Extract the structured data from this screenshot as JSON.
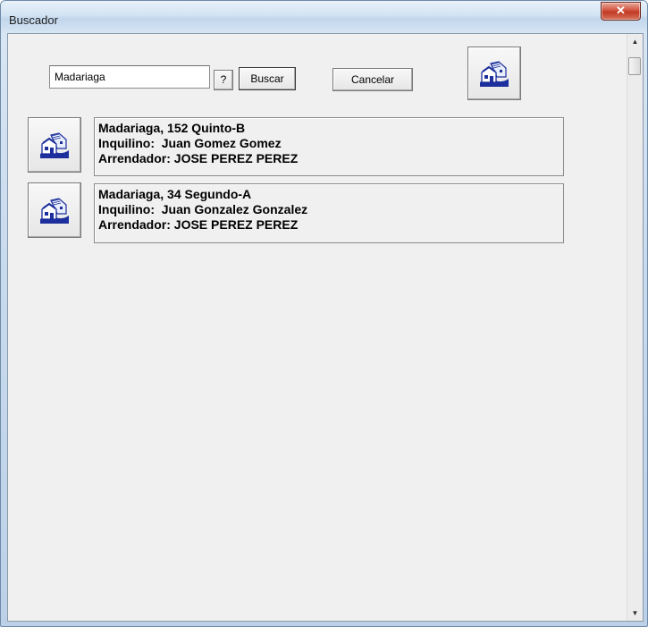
{
  "window": {
    "title": "Buscador",
    "close_glyph": "✕"
  },
  "search": {
    "value": "Madariaga",
    "help_label": "?",
    "search_label": "Buscar",
    "cancel_label": "Cancelar"
  },
  "results": [
    {
      "line1": "Madariaga, 152 Quinto-B",
      "line2": "Inquilino:  Juan Gomez Gomez",
      "line3": "Arrendador: JOSE PEREZ PEREZ"
    },
    {
      "line1": "Madariaga, 34 Segundo-A",
      "line2": "Inquilino:  Juan Gonzalez Gonzalez",
      "line3": "Arrendador: JOSE PEREZ PEREZ"
    }
  ],
  "icons": {
    "house": "house-icon",
    "close": "close-icon"
  },
  "colors": {
    "icon_blue": "#1c2f9c",
    "close_red": "#c9402a"
  }
}
